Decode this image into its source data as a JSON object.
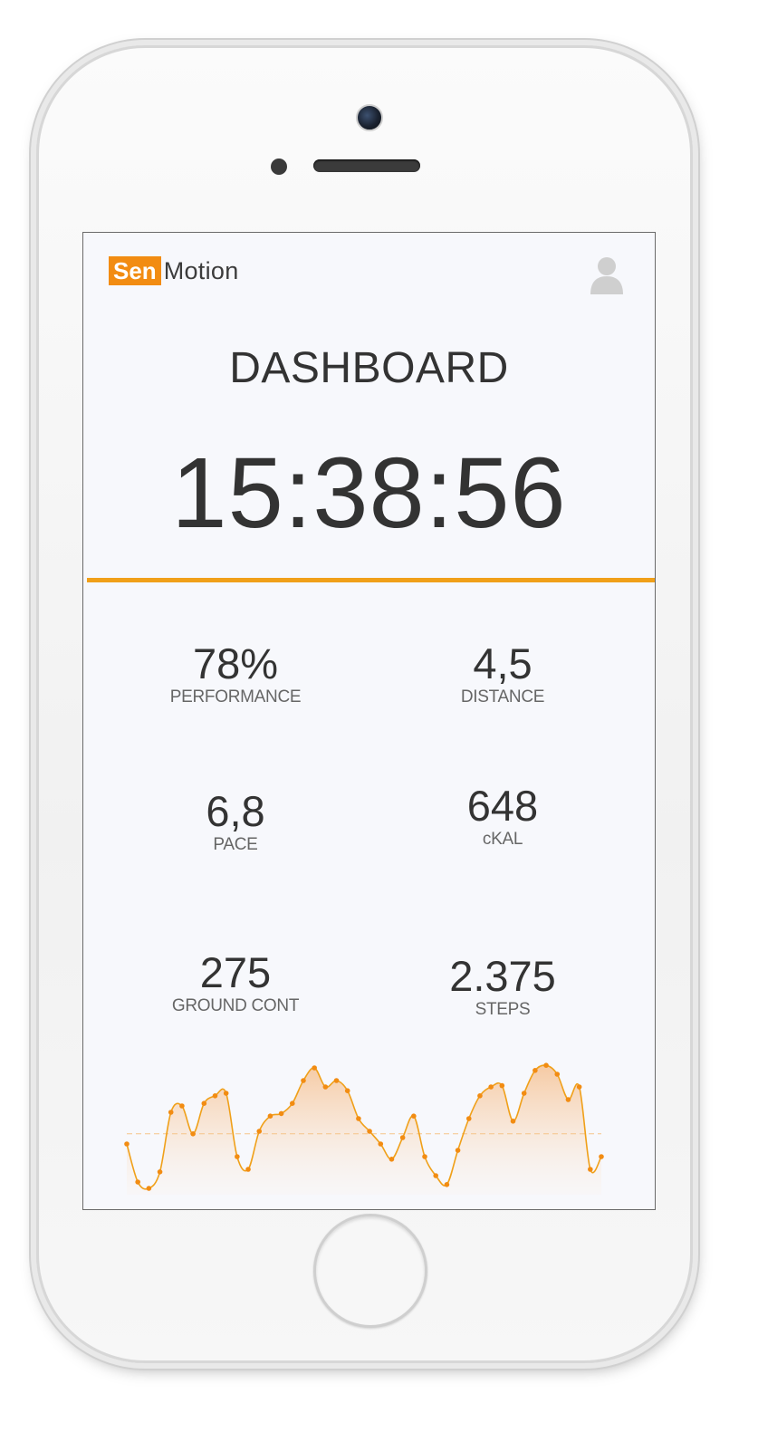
{
  "app": {
    "logo_prefix": "Sen",
    "logo_suffix": "Motion",
    "title": "DASHBOARD",
    "time": "15:38:56",
    "accent_color": "#f0a019",
    "brand_color": "#f28c12"
  },
  "stats": [
    {
      "value": "78%",
      "label": "PERFORMANCE"
    },
    {
      "value": "4,5",
      "label": "DISTANCE"
    },
    {
      "value": "6,8",
      "label": "PACE"
    },
    {
      "value": "648",
      "label": "cKAL"
    },
    {
      "value": "275",
      "label": "GROUND CONT"
    },
    {
      "value": "2.375",
      "label": "STEPS"
    }
  ],
  "icons": {
    "user": "user-avatar-icon"
  },
  "chart_data": {
    "type": "area",
    "title": "",
    "xlabel": "",
    "ylabel": "",
    "grid": false,
    "x": [
      0,
      1,
      2,
      3,
      4,
      5,
      6,
      7,
      8,
      9,
      10,
      11,
      12,
      13,
      14,
      15,
      16,
      17,
      18,
      19,
      20,
      21,
      22,
      23,
      24,
      25,
      26,
      27,
      28,
      29,
      30,
      31,
      32,
      33,
      34,
      35,
      36,
      37,
      38,
      39,
      40,
      41,
      42,
      43
    ],
    "values": [
      40,
      10,
      5,
      18,
      65,
      70,
      48,
      72,
      78,
      80,
      30,
      20,
      50,
      62,
      64,
      72,
      90,
      100,
      85,
      90,
      82,
      60,
      50,
      40,
      28,
      45,
      62,
      30,
      15,
      8,
      35,
      60,
      78,
      85,
      86,
      58,
      80,
      98,
      102,
      95,
      75,
      85,
      20,
      30
    ],
    "reference_line": 48,
    "ylim": [
      0,
      110
    ]
  }
}
